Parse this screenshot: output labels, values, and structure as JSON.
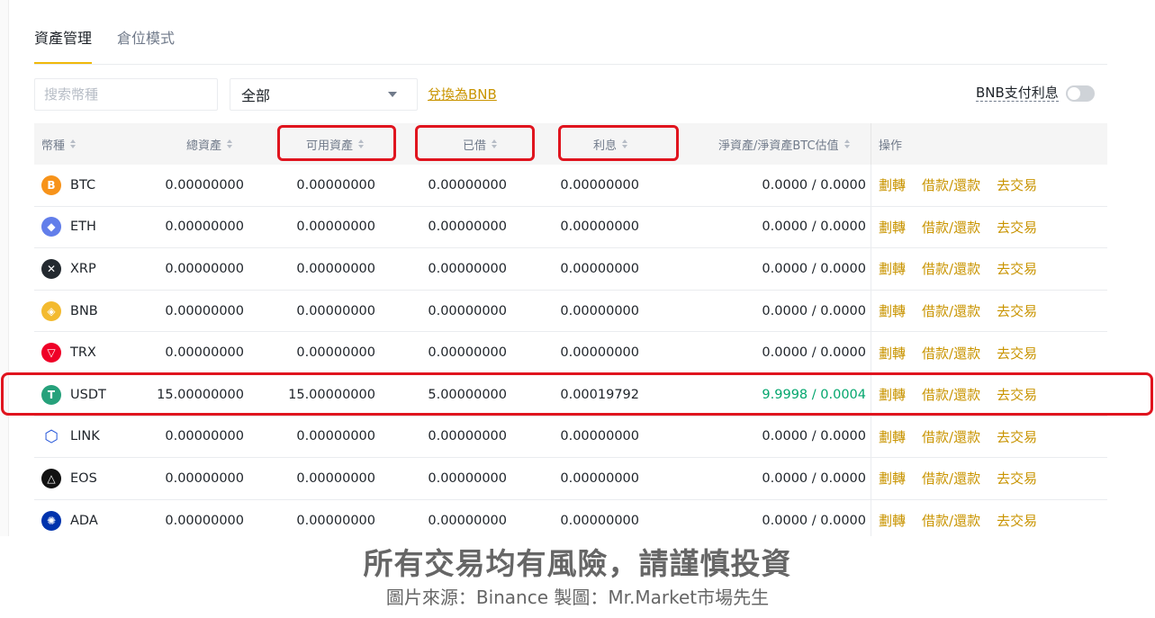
{
  "tabs": [
    {
      "label": "資產管理",
      "active": true
    },
    {
      "label": "倉位模式",
      "active": false
    }
  ],
  "search": {
    "placeholder": "搜索幣種"
  },
  "filter": {
    "selected": "全部"
  },
  "convert_link": "兌換為BNB",
  "bnb_pay": {
    "label": "BNB支付利息",
    "enabled": false
  },
  "table": {
    "headers": {
      "coin": "幣種",
      "total": "總資產",
      "available": "可用資產",
      "borrowed": "已借",
      "interest": "利息",
      "net": "淨資產/淨資產BTC估值",
      "actions": "操作"
    },
    "rows": [
      {
        "coin": "BTC",
        "icon": "btc-icon",
        "color": "#f7931a",
        "glyph": "B",
        "total": "0.00000000",
        "available": "0.00000000",
        "borrowed": "0.00000000",
        "interest": "0.00000000",
        "net": "0.0000 / 0.0000"
      },
      {
        "coin": "ETH",
        "icon": "eth-icon",
        "color": "#627eea",
        "glyph": "◆",
        "total": "0.00000000",
        "available": "0.00000000",
        "borrowed": "0.00000000",
        "interest": "0.00000000",
        "net": "0.0000 / 0.0000"
      },
      {
        "coin": "XRP",
        "icon": "xrp-icon",
        "color": "#23292f",
        "glyph": "✕",
        "total": "0.00000000",
        "available": "0.00000000",
        "borrowed": "0.00000000",
        "interest": "0.00000000",
        "net": "0.0000 / 0.0000"
      },
      {
        "coin": "BNB",
        "icon": "bnb-icon",
        "color": "#f3ba2f",
        "glyph": "◈",
        "total": "0.00000000",
        "available": "0.00000000",
        "borrowed": "0.00000000",
        "interest": "0.00000000",
        "net": "0.0000 / 0.0000"
      },
      {
        "coin": "TRX",
        "icon": "trx-icon",
        "color": "#ef0027",
        "glyph": "▽",
        "total": "0.00000000",
        "available": "0.00000000",
        "borrowed": "0.00000000",
        "interest": "0.00000000",
        "net": "0.0000 / 0.0000"
      },
      {
        "coin": "USDT",
        "icon": "usdt-icon",
        "color": "#26a17b",
        "glyph": "T",
        "total": "15.00000000",
        "available": "15.00000000",
        "borrowed": "5.00000000",
        "interest": "0.00019792",
        "net": "9.9998 / 0.0004",
        "net_positive": true
      },
      {
        "coin": "LINK",
        "icon": "link-icon",
        "color": "#2a5ada",
        "glyph": "⬡",
        "total": "0.00000000",
        "available": "0.00000000",
        "borrowed": "0.00000000",
        "interest": "0.00000000",
        "net": "0.0000 / 0.0000"
      },
      {
        "coin": "EOS",
        "icon": "eos-icon",
        "color": "#111111",
        "glyph": "△",
        "total": "0.00000000",
        "available": "0.00000000",
        "borrowed": "0.00000000",
        "interest": "0.00000000",
        "net": "0.0000 / 0.0000"
      },
      {
        "coin": "ADA",
        "icon": "ada-icon",
        "color": "#0033ad",
        "glyph": "✺",
        "total": "0.00000000",
        "available": "0.00000000",
        "borrowed": "0.00000000",
        "interest": "0.00000000",
        "net": "0.0000 / 0.0000"
      }
    ],
    "actions": [
      "劃轉",
      "借款/還款",
      "去交易"
    ]
  },
  "colors": {
    "accent": "#f0b90b",
    "link": "#c99400",
    "positive": "#03a66d",
    "annotation": "#e0141e"
  },
  "caption": {
    "warning": "所有交易均有風險，請謹慎投資",
    "credit": "圖片來源：Binance  製圖：Mr.Market市場先生"
  }
}
